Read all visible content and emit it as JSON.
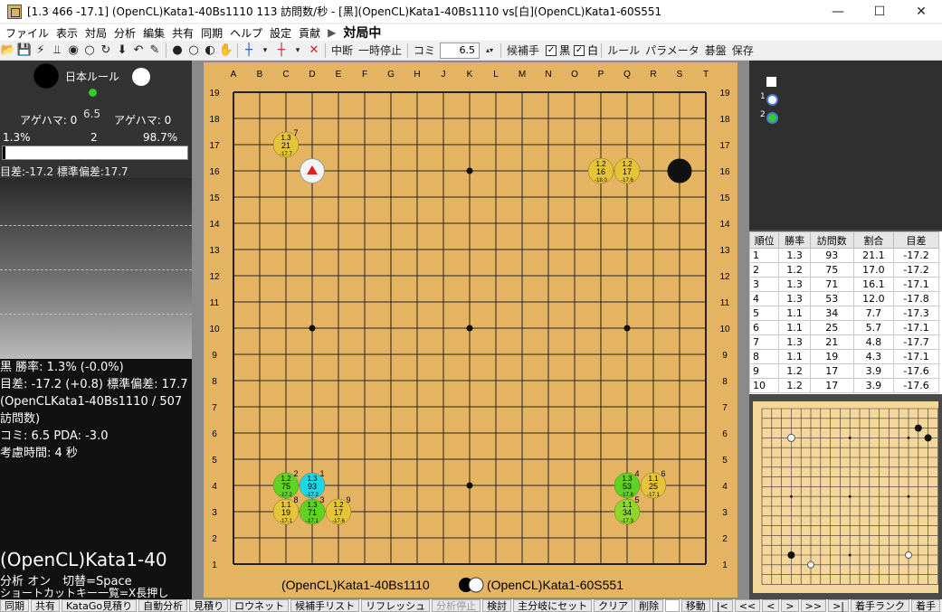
{
  "window": {
    "title": "[1.3 466 -17.1] (OpenCL)Kata1-40Bs1110 113 訪問数/秒 - [黒](OpenCL)Kata1-40Bs1110 vs[白](OpenCL)Kata1-60S551",
    "minimize": "—",
    "maximize": "☐",
    "close": "✕"
  },
  "menu": {
    "items": [
      "ファイル",
      "表示",
      "対局",
      "分析",
      "編集",
      "共有",
      "同期",
      "ヘルプ",
      "設定",
      "貢献"
    ],
    "status_arrow": "▶",
    "status": "対局中"
  },
  "toolbar": {
    "stop": "中断",
    "pause": "一時停止",
    "komi_label": "コミ",
    "komi_value": "6.5",
    "candidates_label": "候補手",
    "black_label": "黒",
    "white_label": "白",
    "rule": "ルール",
    "params": "パラメータ",
    "board": "碁盤",
    "save": "保存"
  },
  "left": {
    "rule": "日本ルール",
    "komi": "6.5",
    "agehama_black": "アゲハマ: 0",
    "agehama_white": "アゲハマ: 0",
    "winrate_black": "1.3%",
    "winrate_mid": "2",
    "winrate_white": "98.7%",
    "winrate_black_fraction": 0.013,
    "score_line": "目差:-17.2 標準偏差:17.7",
    "info": [
      "黒 勝率: 1.3% (-0.0%)",
      "目差: -17.2 (+0.8) 標準偏差: 17.7",
      "(OpenCLKata1-40Bs1110 / 507",
      "訪問数)",
      "コミ: 6.5 PDA: -3.0",
      "考慮時間: 4 秒"
    ],
    "player_name": "(OpenCL)Kata1-40",
    "hint1": "分析 オン　切替=Space",
    "hint2": "ショートカットキー一覧=X長押し"
  },
  "board": {
    "columns": [
      "A",
      "B",
      "C",
      "D",
      "E",
      "F",
      "G",
      "H",
      "J",
      "K",
      "L",
      "M",
      "N",
      "O",
      "P",
      "Q",
      "R",
      "S",
      "T"
    ],
    "black_player": "(OpenCL)Kata1-40Bs1110",
    "white_player": "(OpenCL)Kata1-60S551",
    "stones": [
      {
        "color": "black",
        "col": 18,
        "row": 16
      },
      {
        "color": "white",
        "col": 4,
        "row": 16,
        "last_move": true
      }
    ],
    "candidates": [
      {
        "col": 3,
        "row": 17,
        "wr": "1.3",
        "visits": "21",
        "score": "-17.7",
        "rank": "7",
        "color": "#e6c437"
      },
      {
        "col": 15,
        "row": 16,
        "wr": "1.2",
        "visits": "16",
        "score": "-18.0",
        "rank": "",
        "color": "#e6c437"
      },
      {
        "col": 16,
        "row": 16,
        "wr": "1.2",
        "visits": "17",
        "score": "-17.6",
        "rank": "",
        "color": "#e6c437"
      },
      {
        "col": 3,
        "row": 4,
        "wr": "1.2",
        "visits": "75",
        "score": "-17.2",
        "rank": "2",
        "color": "#5fd321"
      },
      {
        "col": 4,
        "row": 4,
        "wr": "1.3",
        "visits": "93",
        "score": "-17.2",
        "rank": "1",
        "color": "#1fd6e6"
      },
      {
        "col": 3,
        "row": 3,
        "wr": "1.1",
        "visits": "19",
        "score": "-17.1",
        "rank": "8",
        "color": "#e6c437"
      },
      {
        "col": 4,
        "row": 3,
        "wr": "1.3",
        "visits": "71",
        "score": "-17.1",
        "rank": "3",
        "color": "#5fd321"
      },
      {
        "col": 5,
        "row": 3,
        "wr": "1.2",
        "visits": "17",
        "score": "-17.6",
        "rank": "9",
        "color": "#e6c437"
      },
      {
        "col": 16,
        "row": 4,
        "wr": "1.3",
        "visits": "53",
        "score": "-17.8",
        "rank": "4",
        "color": "#5fd321"
      },
      {
        "col": 17,
        "row": 4,
        "wr": "1.1",
        "visits": "25",
        "score": "-17.1",
        "rank": "6",
        "color": "#e6c437"
      },
      {
        "col": 16,
        "row": 3,
        "wr": "1.1",
        "visits": "34",
        "score": "-17.3",
        "rank": "5",
        "color": "#8ed62a"
      }
    ]
  },
  "tree": {
    "label1": "1",
    "label2": "2"
  },
  "table": {
    "headers": [
      "順位",
      "勝率",
      "訪問数",
      "割合",
      "目差"
    ],
    "rows": [
      [
        "1",
        "1.3",
        "93",
        "21.1",
        "-17.2"
      ],
      [
        "2",
        "1.2",
        "75",
        "17.0",
        "-17.2"
      ],
      [
        "3",
        "1.3",
        "71",
        "16.1",
        "-17.1"
      ],
      [
        "4",
        "1.3",
        "53",
        "12.0",
        "-17.8"
      ],
      [
        "5",
        "1.1",
        "34",
        "7.7",
        "-17.3"
      ],
      [
        "6",
        "1.1",
        "25",
        "5.7",
        "-17.1"
      ],
      [
        "7",
        "1.3",
        "21",
        "4.8",
        "-17.7"
      ],
      [
        "8",
        "1.1",
        "19",
        "4.3",
        "-17.1"
      ],
      [
        "9",
        "1.2",
        "17",
        "3.9",
        "-17.6"
      ],
      [
        "10",
        "1.2",
        "17",
        "3.9",
        "-17.6"
      ]
    ]
  },
  "bottom": {
    "buttons": [
      "同期",
      "共有",
      "KataGo見積り",
      "自動分析",
      "見積り",
      "ロウネット",
      "候補手リスト",
      "リフレッシュ",
      "分析停止",
      "検討",
      "主分岐にセット",
      "クリア",
      "削除",
      "",
      "移動",
      "|<",
      "<<",
      "<",
      ">",
      ">>",
      ">|",
      "着手ランク",
      "着手"
    ]
  }
}
